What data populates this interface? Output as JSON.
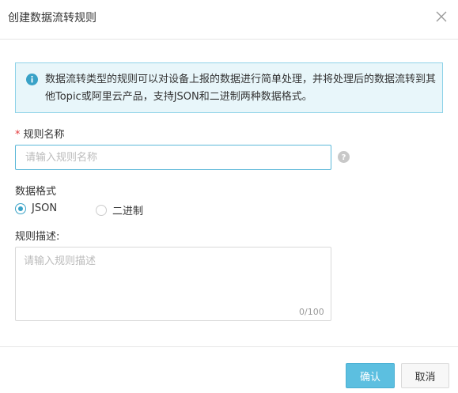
{
  "dialog": {
    "title": "创建数据流转规则",
    "close_icon": "close-icon"
  },
  "info": {
    "icon": "info-icon",
    "text": "数据流转类型的规则可以对设备上报的数据进行简单处理，并将处理后的数据流转到其他Topic或阿里云产品，支持JSON和二进制两种数据格式。",
    "accent": "#39a2c7"
  },
  "form": {
    "rule_name": {
      "required_mark": "*",
      "label": "规则名称",
      "value": "",
      "placeholder": "请输入规则名称",
      "help_icon": "question-icon"
    },
    "data_format": {
      "label": "数据格式",
      "options": [
        {
          "label": "JSON",
          "checked": true
        },
        {
          "label": "二进制",
          "checked": false
        }
      ]
    },
    "description": {
      "label": "规则描述:",
      "value": "",
      "placeholder": "请输入规则描述",
      "counter": "0/100"
    }
  },
  "footer": {
    "confirm_label": "确认",
    "cancel_label": "取消",
    "primary_color": "#5cbfe0"
  }
}
